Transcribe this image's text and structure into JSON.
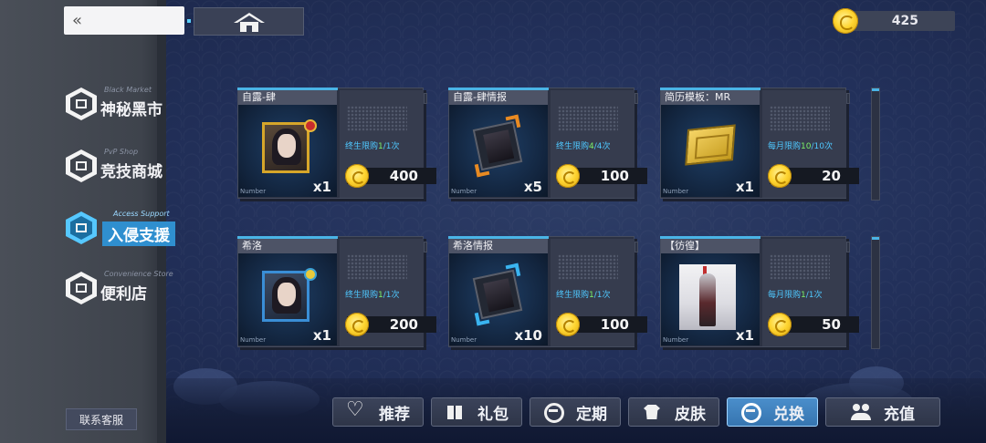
{
  "header": {
    "back_label": "«",
    "coin_count": "425"
  },
  "sidebar": {
    "items": [
      {
        "en": "Black Market",
        "cn": "神秘黑市"
      },
      {
        "en": "PvP Shop",
        "cn": "竞技商城"
      },
      {
        "en": "Access Support",
        "cn": "入侵支援"
      },
      {
        "en": "Convenience Store",
        "cn": "便利店"
      }
    ],
    "active_index": 2,
    "support_label": "联系客服"
  },
  "cards": [
    {
      "name": "自露-肆",
      "limit_prefix": "终生限购",
      "limit_count": "1",
      "limit_suffix": "/1次",
      "number_label": "Number",
      "qty": "x1",
      "price": "400"
    },
    {
      "name": "自露-肆情报",
      "limit_prefix": "终生限购",
      "limit_count": "4",
      "limit_suffix": "/4次",
      "number_label": "Number",
      "qty": "x5",
      "price": "100"
    },
    {
      "name": "简历模板：MR",
      "limit_prefix": "每月限购",
      "limit_count": "10",
      "limit_suffix": "/10次",
      "number_label": "Number",
      "qty": "x1",
      "price": "20"
    },
    {
      "name": "希洛",
      "limit_prefix": "终生限购",
      "limit_count": "1",
      "limit_suffix": "/1次",
      "number_label": "Number",
      "qty": "x1",
      "price": "200"
    },
    {
      "name": "希洛情报",
      "limit_prefix": "终生限购",
      "limit_count": "1",
      "limit_suffix": "/1次",
      "number_label": "Number",
      "qty": "x10",
      "price": "100"
    },
    {
      "name": "【彷徨】",
      "limit_prefix": "每月限购",
      "limit_count": "1",
      "limit_suffix": "/1次",
      "number_label": "Number",
      "qty": "x1",
      "price": "50"
    }
  ],
  "tabs": [
    {
      "label": "推荐",
      "icon": "heart-icon"
    },
    {
      "label": "礼包",
      "icon": "gift-icon"
    },
    {
      "label": "定期",
      "icon": "cycle-icon"
    },
    {
      "label": "皮肤",
      "icon": "shirt-icon"
    },
    {
      "label": "兑换",
      "icon": "cycle-icon"
    },
    {
      "label": "充值",
      "icon": "people-icon"
    }
  ],
  "active_tab_index": 4,
  "colors": {
    "accent": "#4ab4e6",
    "limit_text": "#4fc8ff",
    "limit_highlight": "#7cf26a",
    "active_tab": "#3675b0"
  }
}
